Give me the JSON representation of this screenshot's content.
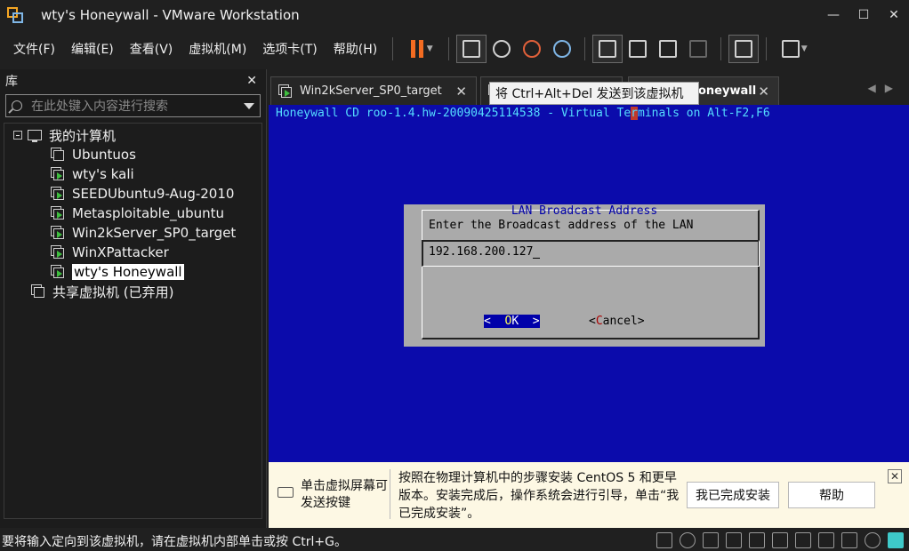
{
  "window": {
    "title": "wty's Honeywall - VMware Workstation"
  },
  "menu": {
    "file": "文件(F)",
    "edit": "编辑(E)",
    "view": "查看(V)",
    "vm": "虚拟机(M)",
    "tabs": "选项卡(T)",
    "help": "帮助(H)"
  },
  "library": {
    "title": "库",
    "search_placeholder": "在此处键入内容进行搜索",
    "root": "我的计算机",
    "vms": [
      "Ubuntuos",
      "wty's kali",
      "SEEDUbuntu9-Aug-2010",
      "Metasploitable_ubuntu",
      "Win2kServer_SP0_target",
      "WinXPattacker",
      "wty's Honeywall"
    ],
    "selected_vm": "wty's Honeywall",
    "shared": "共享虚拟机 (已弃用)"
  },
  "tabs": {
    "tab1": "Win2kServer_SP0_target",
    "tab3": "oneywall",
    "tooltip": "将 Ctrl+Alt+Del 发送到该虚拟机"
  },
  "console": {
    "header_pre": "Honeywall CD roo-1.4.hw-20090425114538 - Virtual Te",
    "header_cur": "r",
    "header_post": "minals on Alt-F2,F6",
    "dialog_title": "LAN Broadcast Address",
    "dialog_prompt": "Enter the Broadcast address of the LAN",
    "input_value": "192.168.200.127",
    "ok_pre": "<  ",
    "ok_hot": "O",
    "ok_post": "K  >",
    "cancel_pre": "<",
    "cancel_hot": "C",
    "cancel_post": "ancel>"
  },
  "banner": {
    "left_text": "单击虚拟屏幕可发送按键",
    "message": "按照在物理计算机中的步骤安装 CentOS 5 和更早版本。安装完成后，操作系统会进行引导，单击“我已完成安装”。",
    "done_button": "我已完成安装",
    "help_button": "帮助",
    "close": "✕"
  },
  "status": {
    "text": "要将输入定向到该虚拟机，请在虚拟机内部单击或按 Ctrl+G。"
  },
  "colors": {
    "console_bg": "#0b0bab",
    "dialog_bg": "#aaaaaa",
    "pause": "#f36b21",
    "banner_bg": "#fdf8e4"
  }
}
